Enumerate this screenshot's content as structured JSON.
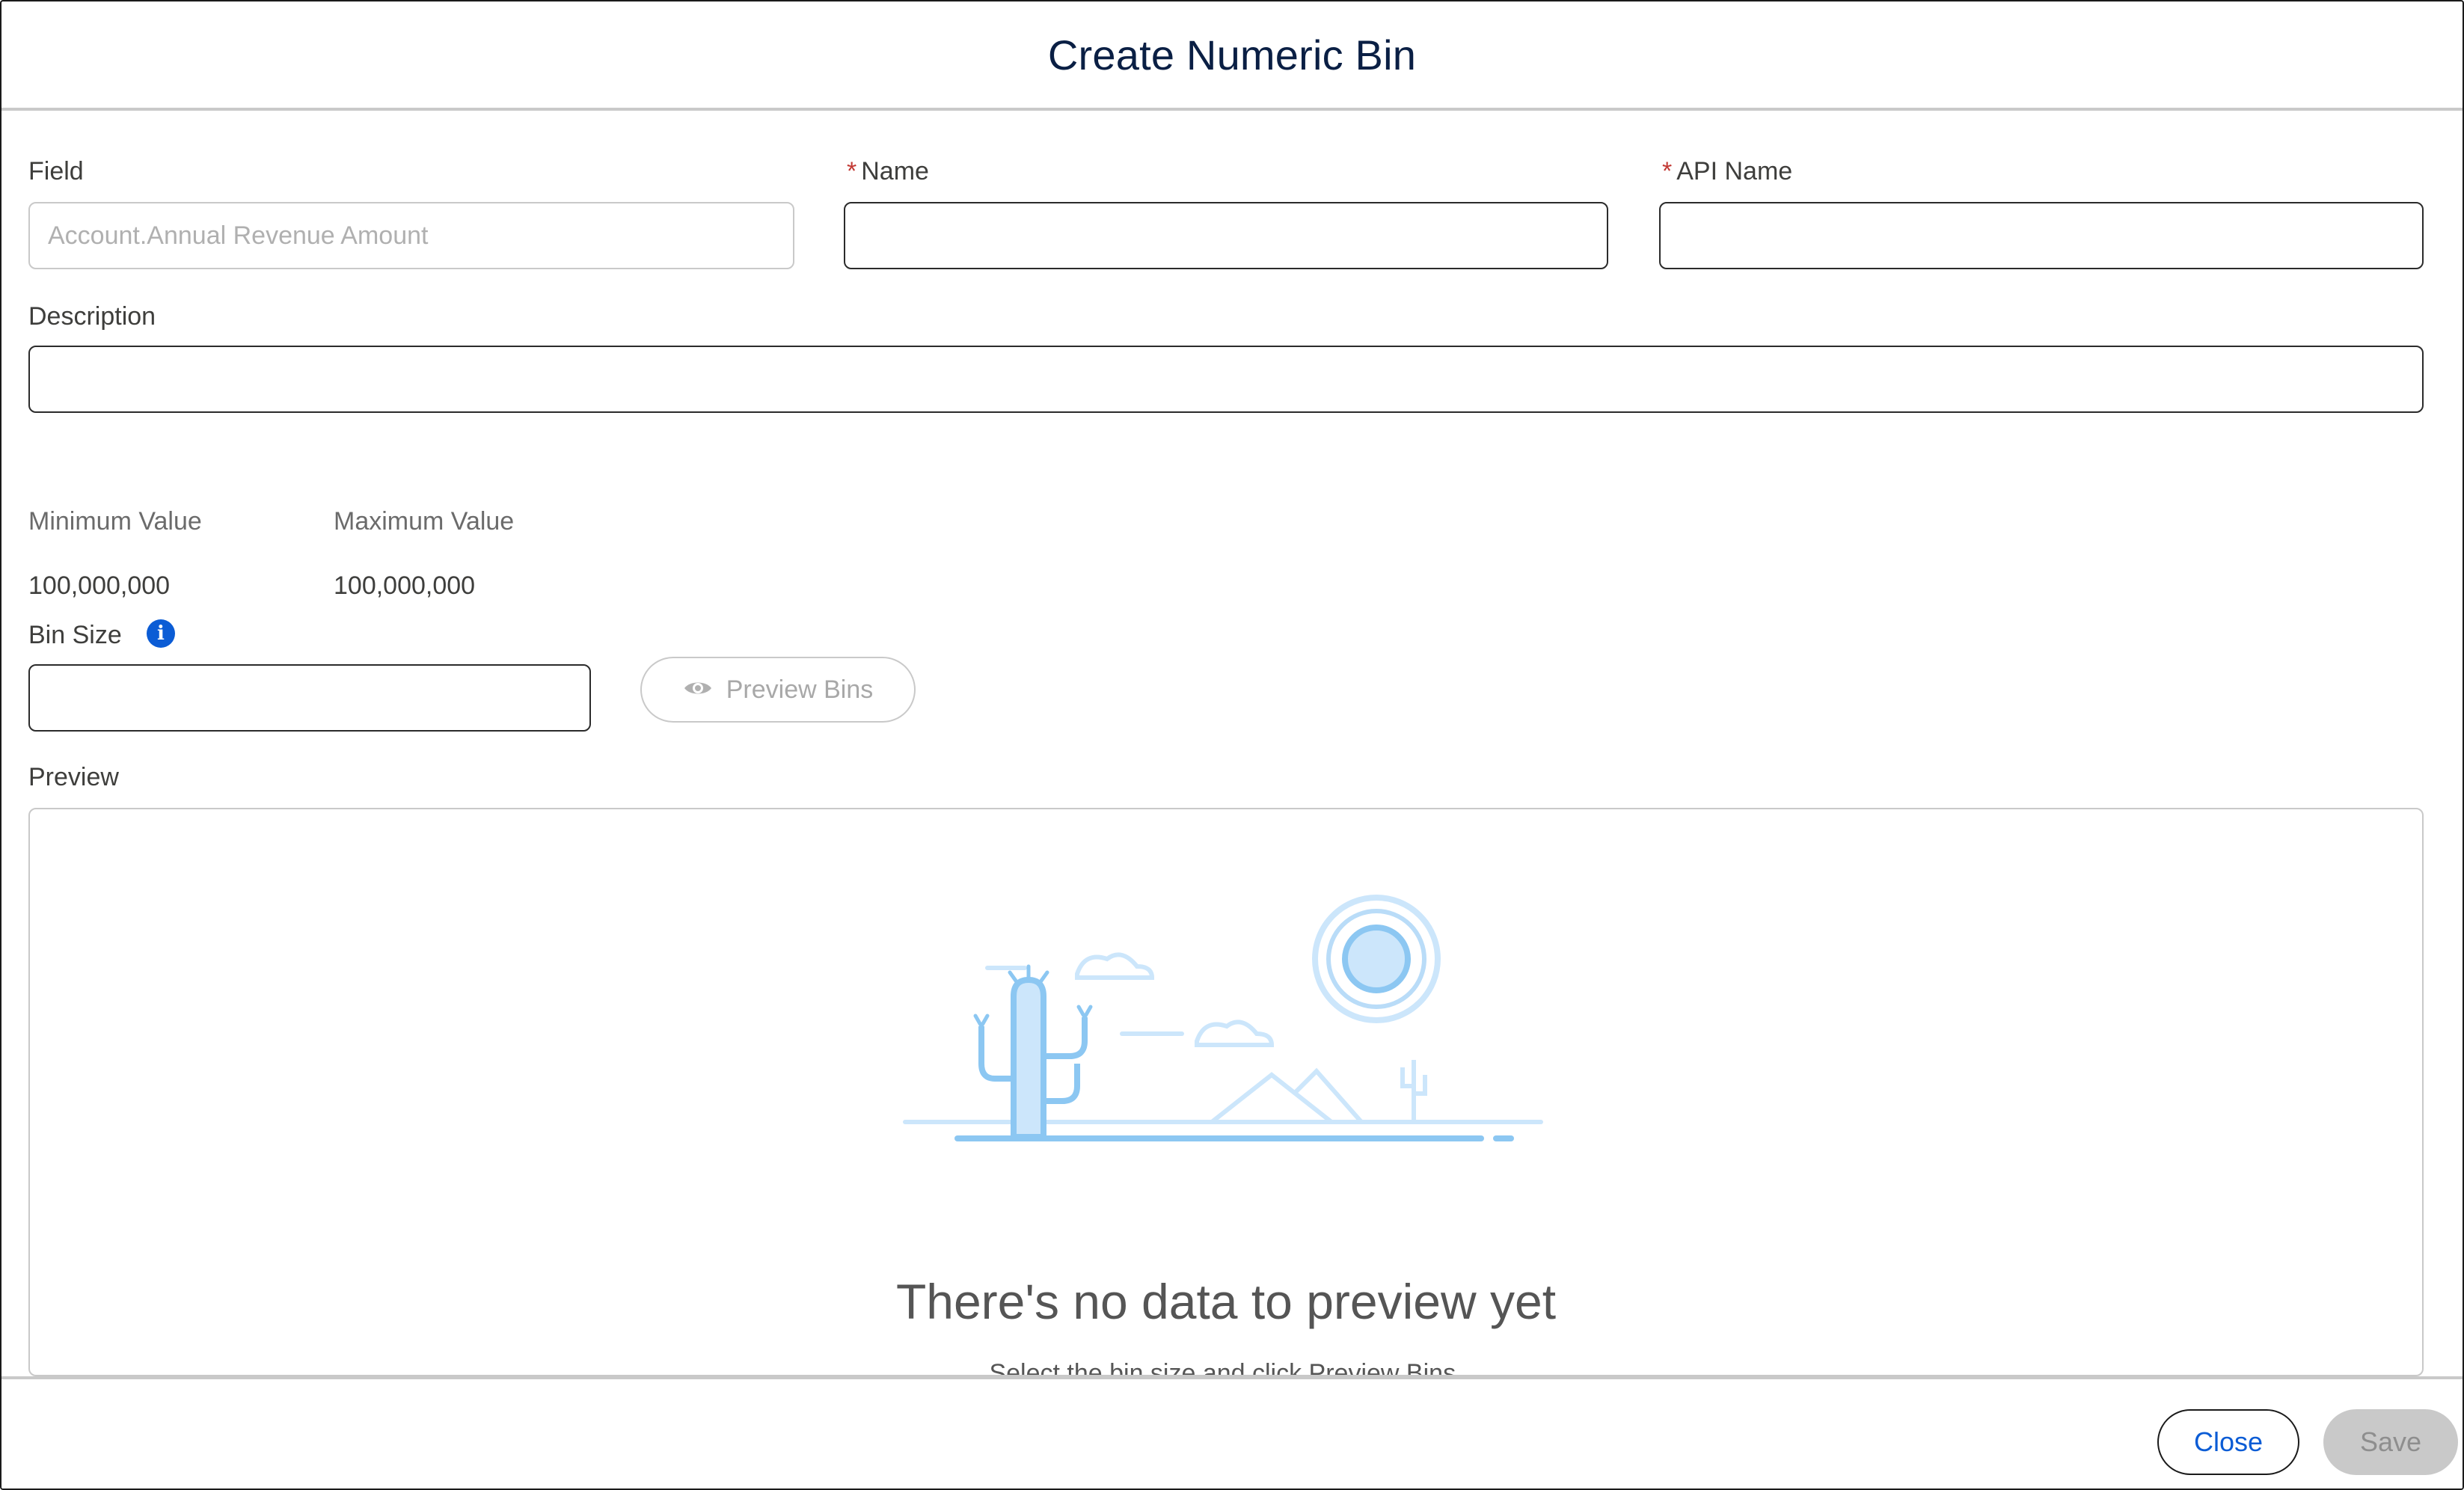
{
  "modal": {
    "title": "Create Numeric Bin"
  },
  "form": {
    "field": {
      "label": "Field",
      "value": "Account.Annual Revenue Amount"
    },
    "name": {
      "label": "Name",
      "required_marker": "*",
      "value": ""
    },
    "api_name": {
      "label": "API Name",
      "required_marker": "*",
      "value": ""
    },
    "description": {
      "label": "Description",
      "value": ""
    },
    "minimum": {
      "label": "Minimum Value",
      "value": "100,000,000"
    },
    "maximum": {
      "label": "Maximum Value",
      "value": "100,000,000"
    },
    "bin_size": {
      "label": "Bin Size",
      "value": "",
      "info_icon": "info-icon"
    },
    "preview_button": {
      "label": "Preview Bins",
      "icon": "eye-icon"
    }
  },
  "preview": {
    "label": "Preview",
    "empty_title": "There's no data to preview yet",
    "empty_subtitle": "Select the bin size and click Preview Bins.",
    "illustration": "desert-illustration"
  },
  "footer": {
    "close_label": "Close",
    "save_label": "Save"
  },
  "colors": {
    "title": "#0a1f44",
    "required": "#c23934",
    "brand": "#0b5cd5",
    "border_light": "#c9c9c9",
    "illustration_fill": "#cce6fb",
    "illustration_stroke": "#8cc7f2"
  }
}
